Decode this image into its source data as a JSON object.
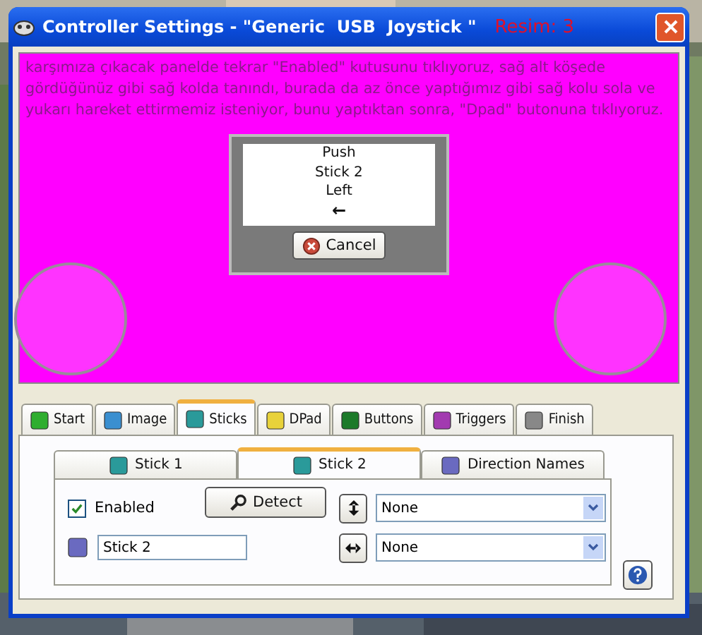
{
  "window": {
    "title": "Controller Settings - \"Generic  USB  Joystick \"",
    "annotation": "Resim: 3"
  },
  "instructions": "karşımıza çıkacak panelde tekrar \"Enabled\" kutusunu tıklıyoruz, sağ alt köşede gördüğünüz gibi sağ kolda tanındı, burada da az önce yaptığımız gibi sağ kolu sola ve yukarı hareket ettirmemiz isteniyor, bunu yaptıktan sonra, \"Dpad\" butonuna tıklıyoruz.",
  "prompt": {
    "lines": [
      "Push",
      "Stick 2",
      "Left"
    ],
    "arrow": "←",
    "cancel": "Cancel"
  },
  "tabs": [
    {
      "label": "Start",
      "selected": false,
      "kind": "start"
    },
    {
      "label": "Image",
      "selected": false
    },
    {
      "label": "Sticks",
      "selected": true,
      "kind": "sticks"
    },
    {
      "label": "DPad",
      "selected": false,
      "kind": "dpad"
    },
    {
      "label": "Buttons",
      "selected": false,
      "kind": "buttons"
    },
    {
      "label": "Triggers",
      "selected": false,
      "kind": "triggers"
    },
    {
      "label": "Finish",
      "selected": false,
      "kind": "finish"
    }
  ],
  "subtabs": [
    {
      "label": "Stick 1",
      "selected": false,
      "kind": "stick"
    },
    {
      "label": "Stick 2",
      "selected": true,
      "kind": "stick"
    },
    {
      "label": "Direction Names",
      "selected": false,
      "kind": "names"
    }
  ],
  "enabled": {
    "label": "Enabled",
    "checked": true
  },
  "detect": "Detect",
  "name_field": {
    "value": "Stick 2"
  },
  "axes": [
    {
      "kind": "vertical",
      "value": "None"
    },
    {
      "kind": "horizontal",
      "value": "None"
    }
  ]
}
